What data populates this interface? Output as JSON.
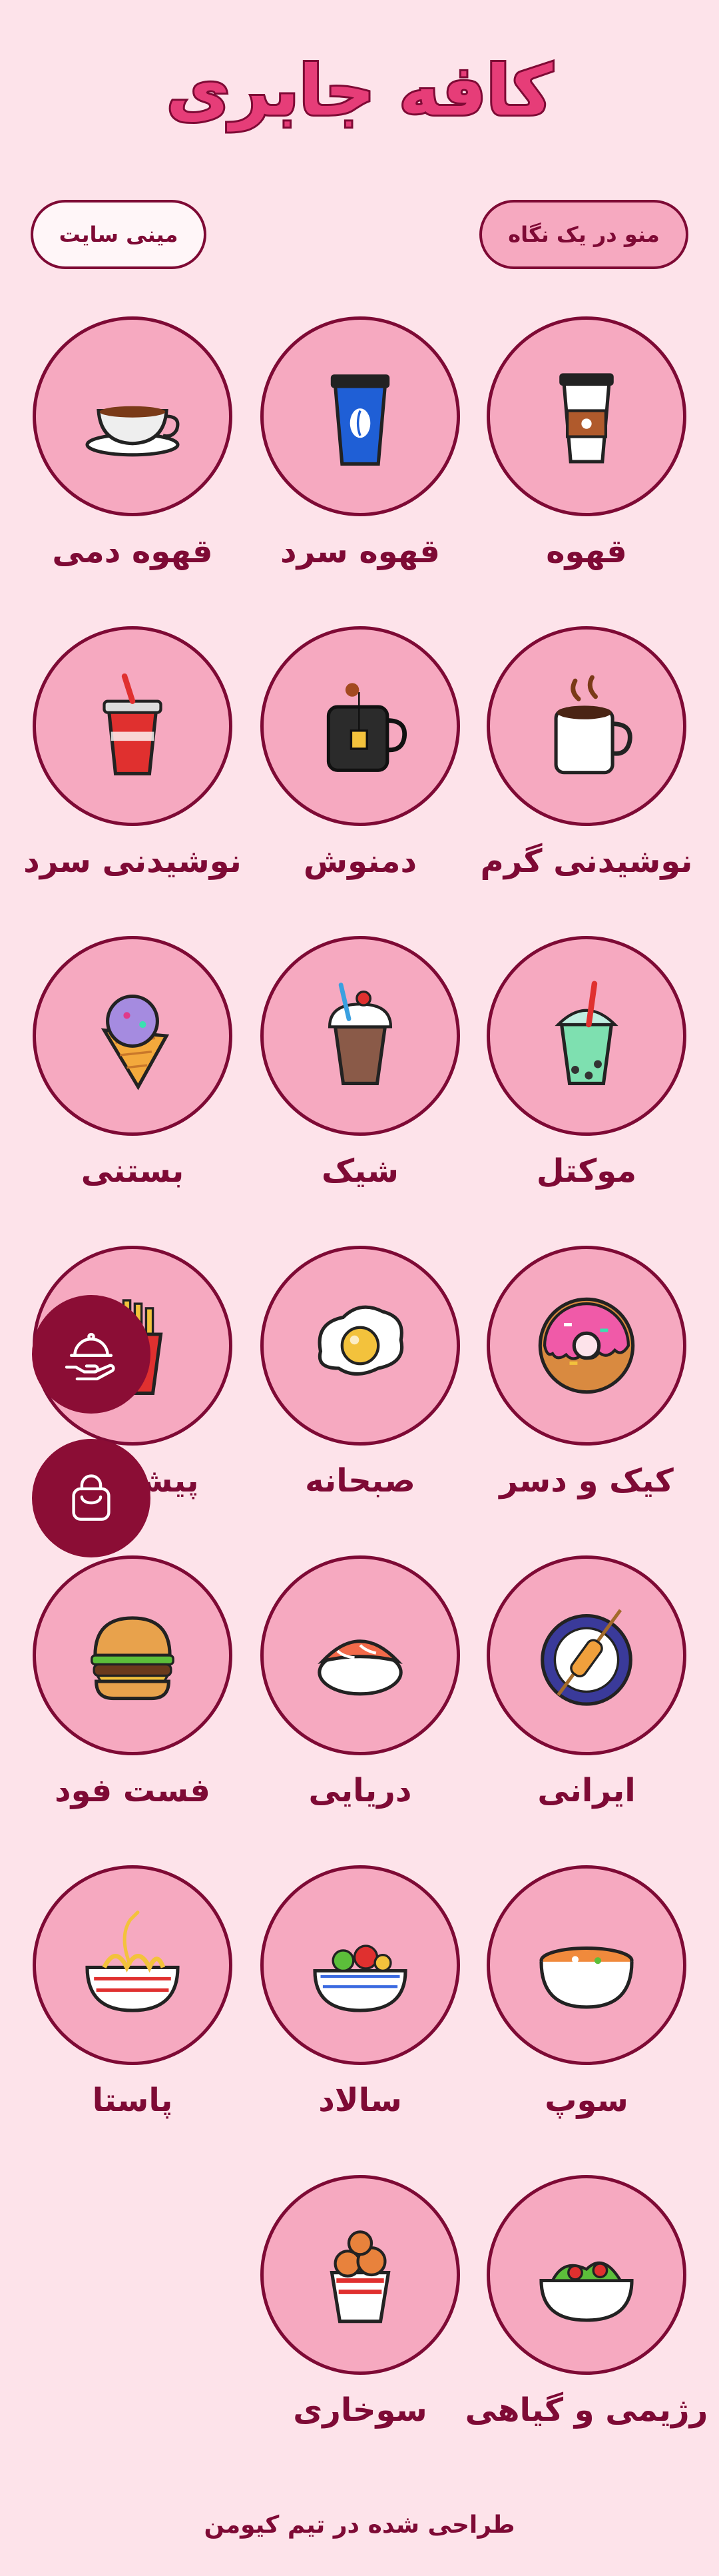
{
  "header": {
    "title": "کافه جابری"
  },
  "top_buttons": {
    "menu_glance": "منو در یک نگاه",
    "mini_site": "مینی سایت"
  },
  "categories": [
    {
      "label": "قهوه",
      "icon": "coffee-cup-icon"
    },
    {
      "label": "قهوه سرد",
      "icon": "cold-coffee-icon"
    },
    {
      "label": "قهوه دمی",
      "icon": "tea-cup-icon"
    },
    {
      "label": "نوشیدنی گرم",
      "icon": "hot-drink-mug-icon"
    },
    {
      "label": "دمنوش",
      "icon": "herbal-tea-mug-icon"
    },
    {
      "label": "نوشیدنی سرد",
      "icon": "soda-cup-icon"
    },
    {
      "label": "موکتل",
      "icon": "mocktail-icon"
    },
    {
      "label": "شیک",
      "icon": "milkshake-icon"
    },
    {
      "label": "بستنی",
      "icon": "ice-cream-cone-icon"
    },
    {
      "label": "کیک و دسر",
      "icon": "donut-icon"
    },
    {
      "label": "صبحانه",
      "icon": "fried-egg-icon"
    },
    {
      "label": "پیش غذا",
      "icon": "french-fries-icon"
    },
    {
      "label": "ایرانی",
      "icon": "kebab-rice-icon"
    },
    {
      "label": "دریایی",
      "icon": "sushi-icon"
    },
    {
      "label": "فست فود",
      "icon": "burger-icon"
    },
    {
      "label": "سوپ",
      "icon": "soup-bowl-icon"
    },
    {
      "label": "سالاد",
      "icon": "salad-bowl-icon"
    },
    {
      "label": "پاستا",
      "icon": "noodles-bowl-icon"
    },
    {
      "label": "رژیمی و گیاهی",
      "icon": "veggie-bowl-icon"
    },
    {
      "label": "سوخاری",
      "icon": "fried-chicken-icon"
    }
  ],
  "floating_buttons": [
    "waiter-service-icon",
    "shopping-bag-icon"
  ],
  "footer": {
    "text": "طراحی شده در تیم کیومن"
  },
  "colors": {
    "background": "#fde3ea",
    "circle": "#f6a9c0",
    "accent": "#7e0a35",
    "title": "#e63d78",
    "fab": "#8b0d35"
  }
}
